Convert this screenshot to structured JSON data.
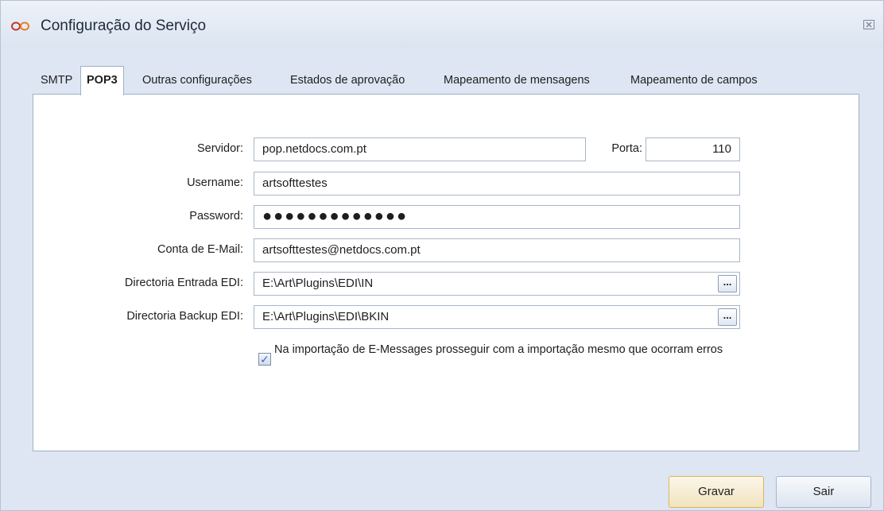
{
  "window": {
    "title": "Configuração do Serviço",
    "icon": "infinity-logo-icon",
    "close_icon": "close-icon"
  },
  "tabs": [
    {
      "label": "SMTP",
      "active": false
    },
    {
      "label": "POP3",
      "active": true
    },
    {
      "label": "Outras configurações",
      "active": false
    },
    {
      "label": "Estados de aprovação",
      "active": false
    },
    {
      "label": "Mapeamento de mensagens",
      "active": false
    },
    {
      "label": "Mapeamento de campos",
      "active": false
    }
  ],
  "form": {
    "servidor": {
      "label": "Servidor:",
      "value": "pop.netdocs.com.pt"
    },
    "porta": {
      "label": "Porta:",
      "value": "110"
    },
    "username": {
      "label": "Username:",
      "value": "artsofttestes"
    },
    "password": {
      "label": "Password:",
      "value": "●●●●●●●●●●●●●"
    },
    "conta_email": {
      "label": "Conta de E-Mail:",
      "value": "artsofttestes@netdocs.com.pt"
    },
    "dir_entrada": {
      "label": "Directoria Entrada EDI:",
      "value": "E:\\Art\\Plugins\\EDI\\IN",
      "browse_label": "..."
    },
    "dir_backup": {
      "label": "Directoria Backup EDI:",
      "value": "E:\\Art\\Plugins\\EDI\\BKIN",
      "browse_label": "..."
    },
    "continue_on_errors": {
      "label": "Na importação de E-Messages prosseguir com a importação mesmo que ocorram erros",
      "checked": true
    }
  },
  "buttons": {
    "save": "Gravar",
    "exit": "Sair"
  },
  "colors": {
    "window_bg": "#dde6f2",
    "panel_bg": "#ffffff",
    "accent_border": "#e0b45a",
    "icon_red": "#c0392b"
  }
}
